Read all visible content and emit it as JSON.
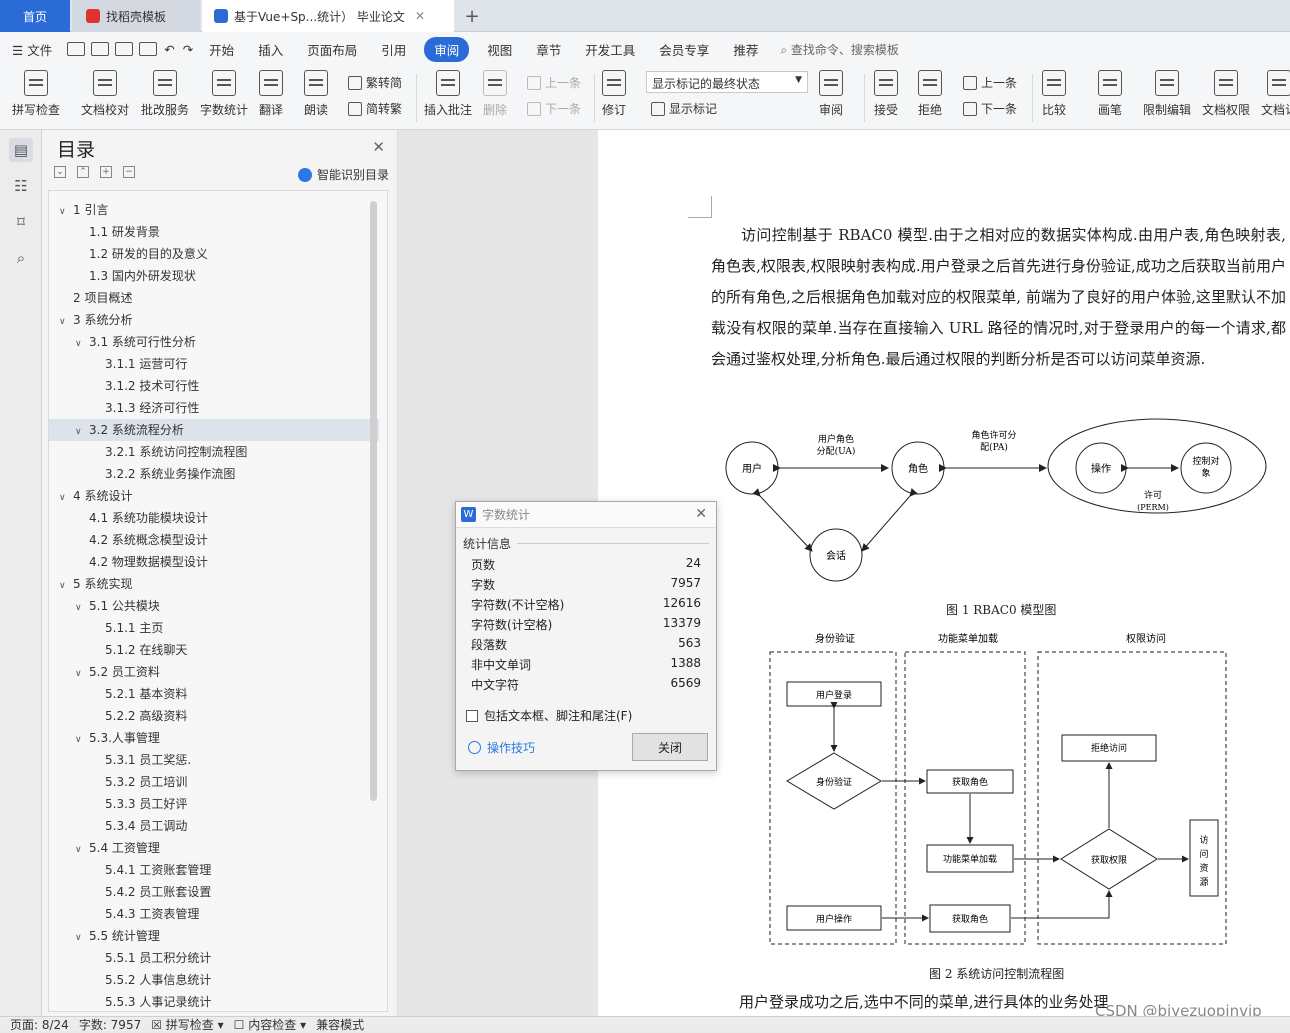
{
  "tabs": {
    "home": "首页",
    "template": "找稻壳模板",
    "doc": "基于Vue+Sp...统计） 毕业论文",
    "add": "+"
  },
  "menu": {
    "file": "文件",
    "items": [
      "开始",
      "插入",
      "页面布局",
      "引用",
      "审阅",
      "视图",
      "章节",
      "开发工具",
      "会员专享",
      "推荐"
    ],
    "search": "查找命令、搜索模板"
  },
  "ribbon": {
    "spell": "拼写检查",
    "proof": "文档校对",
    "batch": "批改服务",
    "wordcount": "字数统计",
    "translate": "翻译",
    "read": "朗读",
    "t2s": "繁转简",
    "s2t": "简转繁",
    "insert_comment": "插入批注",
    "delete": "删除",
    "prev": "上一条",
    "next": "下一条",
    "track": "修订",
    "show_marks": "显示标记",
    "mark_state": "显示标记的最终状态",
    "review": "审阅",
    "accept": "接受",
    "reject": "拒绝",
    "prev2": "上一条",
    "next2": "下一条",
    "compare": "比较",
    "pen": "画笔",
    "restrict": "限制编辑",
    "doc_perm": "文档权限",
    "doc_more": "文档认"
  },
  "toc": {
    "title": "目录",
    "smart": "智能识别目录",
    "items": [
      {
        "text": "1 引言",
        "lv": 0,
        "arrow": "v"
      },
      {
        "text": "1.1 研发背景",
        "lv": 1,
        "arrow": ""
      },
      {
        "text": "1.2 研发的目的及意义",
        "lv": 1,
        "arrow": ""
      },
      {
        "text": "1.3 国内外研发现状",
        "lv": 1,
        "arrow": ""
      },
      {
        "text": "2 项目概述",
        "lv": 0,
        "arrow": ""
      },
      {
        "text": "3 系统分析",
        "lv": 0,
        "arrow": "v"
      },
      {
        "text": "3.1 系统可行性分析",
        "lv": 1,
        "arrow": "v"
      },
      {
        "text": "3.1.1 运营可行",
        "lv": 2,
        "arrow": ""
      },
      {
        "text": "3.1.2 技术可行性",
        "lv": 2,
        "arrow": ""
      },
      {
        "text": "3.1.3 经济可行性",
        "lv": 2,
        "arrow": ""
      },
      {
        "text": "3.2 系统流程分析",
        "lv": 1,
        "arrow": "v",
        "sel": true
      },
      {
        "text": "3.2.1 系统访问控制流程图",
        "lv": 2,
        "arrow": ""
      },
      {
        "text": "3.2.2 系统业务操作流图",
        "lv": 2,
        "arrow": ""
      },
      {
        "text": "4 系统设计",
        "lv": 0,
        "arrow": "v"
      },
      {
        "text": "4.1 系统功能模块设计",
        "lv": 1,
        "arrow": ""
      },
      {
        "text": "4.2 系统概念模型设计",
        "lv": 1,
        "arrow": ""
      },
      {
        "text": "4.2 物理数据模型设计",
        "lv": 1,
        "arrow": ""
      },
      {
        "text": "5 系统实现",
        "lv": 0,
        "arrow": "v"
      },
      {
        "text": "5.1 公共模块",
        "lv": 1,
        "arrow": "v"
      },
      {
        "text": "5.1.1 主页",
        "lv": 2,
        "arrow": ""
      },
      {
        "text": "5.1.2 在线聊天",
        "lv": 2,
        "arrow": ""
      },
      {
        "text": "5.2 员工资料",
        "lv": 1,
        "arrow": "v"
      },
      {
        "text": "5.2.1 基本资料",
        "lv": 2,
        "arrow": ""
      },
      {
        "text": "5.2.2 高级资料",
        "lv": 2,
        "arrow": ""
      },
      {
        "text": "5.3.人事管理",
        "lv": 1,
        "arrow": "v"
      },
      {
        "text": "5.3.1 员工奖惩.",
        "lv": 2,
        "arrow": ""
      },
      {
        "text": "5.3.2 员工培训",
        "lv": 2,
        "arrow": ""
      },
      {
        "text": "5.3.3 员工好评",
        "lv": 2,
        "arrow": ""
      },
      {
        "text": "5.3.4 员工调动",
        "lv": 2,
        "arrow": ""
      },
      {
        "text": "5.4 工资管理",
        "lv": 1,
        "arrow": "v"
      },
      {
        "text": "5.4.1 工资账套管理",
        "lv": 2,
        "arrow": ""
      },
      {
        "text": "5.4.2 员工账套设置",
        "lv": 2,
        "arrow": ""
      },
      {
        "text": "5.4.3 工资表管理",
        "lv": 2,
        "arrow": ""
      },
      {
        "text": "5.5 统计管理",
        "lv": 1,
        "arrow": "v"
      },
      {
        "text": "5.5.1 员工积分统计",
        "lv": 2,
        "arrow": ""
      },
      {
        "text": "5.5.2 人事信息统计",
        "lv": 2,
        "arrow": ""
      },
      {
        "text": "5.5.3 人事记录统计",
        "lv": 2,
        "arrow": ""
      }
    ]
  },
  "doc": {
    "paragraph": "访问控制基于 RBAC0 模型.由于之相对应的数据实体构成.由用户表,角色映射表,角色表,权限表,权限映射表构成.用户登录之后首先进行身份验证,成功之后获取当前用户的所有角色,之后根据角色加载对应的权限菜单, 前端为了良好的用户体验,这里默认不加载没有权限的菜单.当存在直接输入 URL 路径的情况时,对于登录用户的每一个请求,都会通过鉴权处理,分析角色.最后通过权限的判断分析是否可以访问菜单资源.",
    "fig1": {
      "user": "用户",
      "role": "角色",
      "session": "会话",
      "ua1": "用户角色",
      "ua2": "分配(UA)",
      "pa1": "角色许可分",
      "pa2": "配(PA)",
      "op": "操作",
      "obj1": "控制对",
      "obj2": "象",
      "perm1": "许可",
      "perm2": "(PERM)"
    },
    "fig1_caption": "图 1 RBAC0 模型图",
    "fig2": {
      "lane1": "身份验证",
      "lane2": "功能菜单加载",
      "lane3": "权限访问",
      "login": "用户登录",
      "verify": "身份验证",
      "getrole": "获取角色",
      "menu": "功能菜单加载",
      "getperm": "获取权限",
      "deny": "拒绝访问",
      "userop": "用户操作",
      "getrole2": "获取角色",
      "res1": "访",
      "res2": "问",
      "res3": "资",
      "res4": "源"
    },
    "fig2_caption": "图 2  系统访问控制流程图",
    "after": "用户登录成功之后,选中不同的菜单,进行具体的业务处理"
  },
  "dialog": {
    "title": "字数统计",
    "section": "统计信息",
    "rows": [
      {
        "k": "页数",
        "v": "24"
      },
      {
        "k": "字数",
        "v": "7957"
      },
      {
        "k": "字符数(不计空格)",
        "v": "12616"
      },
      {
        "k": "字符数(计空格)",
        "v": "13379"
      },
      {
        "k": "段落数",
        "v": "563"
      },
      {
        "k": "非中文单词",
        "v": "1388"
      },
      {
        "k": "中文字符",
        "v": "6569"
      }
    ],
    "checkbox": "包括文本框、脚注和尾注(F)",
    "tips": "操作技巧",
    "close": "关闭"
  },
  "status": {
    "page": "页面: 8/24",
    "words": "字数: 7957",
    "spell": "拼写检查",
    "content": "内容检查",
    "compat": "兼容模式"
  },
  "watermark": "CSDN @biyezuopinvip"
}
